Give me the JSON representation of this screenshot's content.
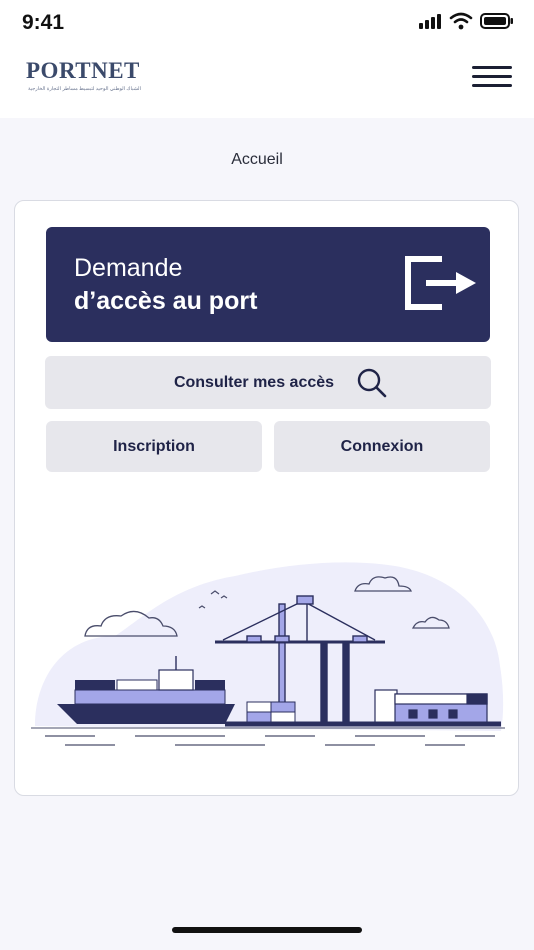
{
  "status_bar": {
    "time": "9:41"
  },
  "header": {
    "logo_text": "PORTNET",
    "logo_subtitle": "الشباك الوطني الوحيد لتبسيط مساطر التجارة الخارجية"
  },
  "page": {
    "title": "Accueil"
  },
  "hero": {
    "line1": "Demande",
    "line2": "d’accès au port"
  },
  "actions": {
    "consult_label": "Consulter mes accès",
    "register_label": "Inscription",
    "login_label": "Connexion"
  },
  "colors": {
    "primary": "#2b2f5e",
    "button_bg": "#e7e7ec",
    "page_bg": "#f6f6fb",
    "illustration_accent": "#a3a6e8"
  },
  "icons": [
    "signal-icon",
    "wifi-icon",
    "battery-icon",
    "menu-icon",
    "exit-arrow-icon",
    "search-icon"
  ]
}
